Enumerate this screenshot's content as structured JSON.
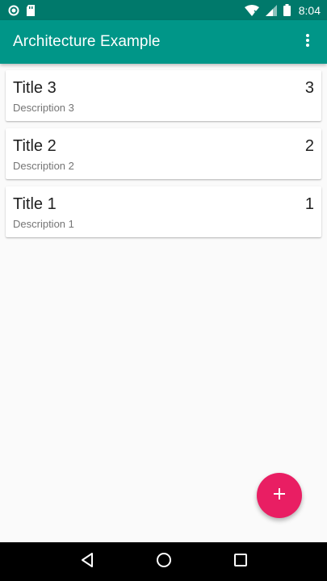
{
  "status_bar": {
    "time": "8:04",
    "icons": [
      "circle-notification-icon",
      "sd-card-icon",
      "wifi-icon",
      "cell-signal-icon",
      "battery-icon"
    ]
  },
  "app_bar": {
    "title": "Architecture Example",
    "overflow_icon": "more-vert-icon"
  },
  "items": [
    {
      "title": "Title 3",
      "description": "Description 3",
      "count": "3"
    },
    {
      "title": "Title 2",
      "description": "Description 2",
      "count": "2"
    },
    {
      "title": "Title 1",
      "description": "Description 1",
      "count": "1"
    }
  ],
  "fab": {
    "icon": "add-icon"
  },
  "nav_bar": {
    "icons": [
      "back-icon",
      "home-icon",
      "recents-icon"
    ]
  },
  "colors": {
    "status_bar": "#00796b",
    "app_bar": "#009688",
    "fab": "#e91e63",
    "background": "#fafafa",
    "nav_bar": "#000000"
  }
}
